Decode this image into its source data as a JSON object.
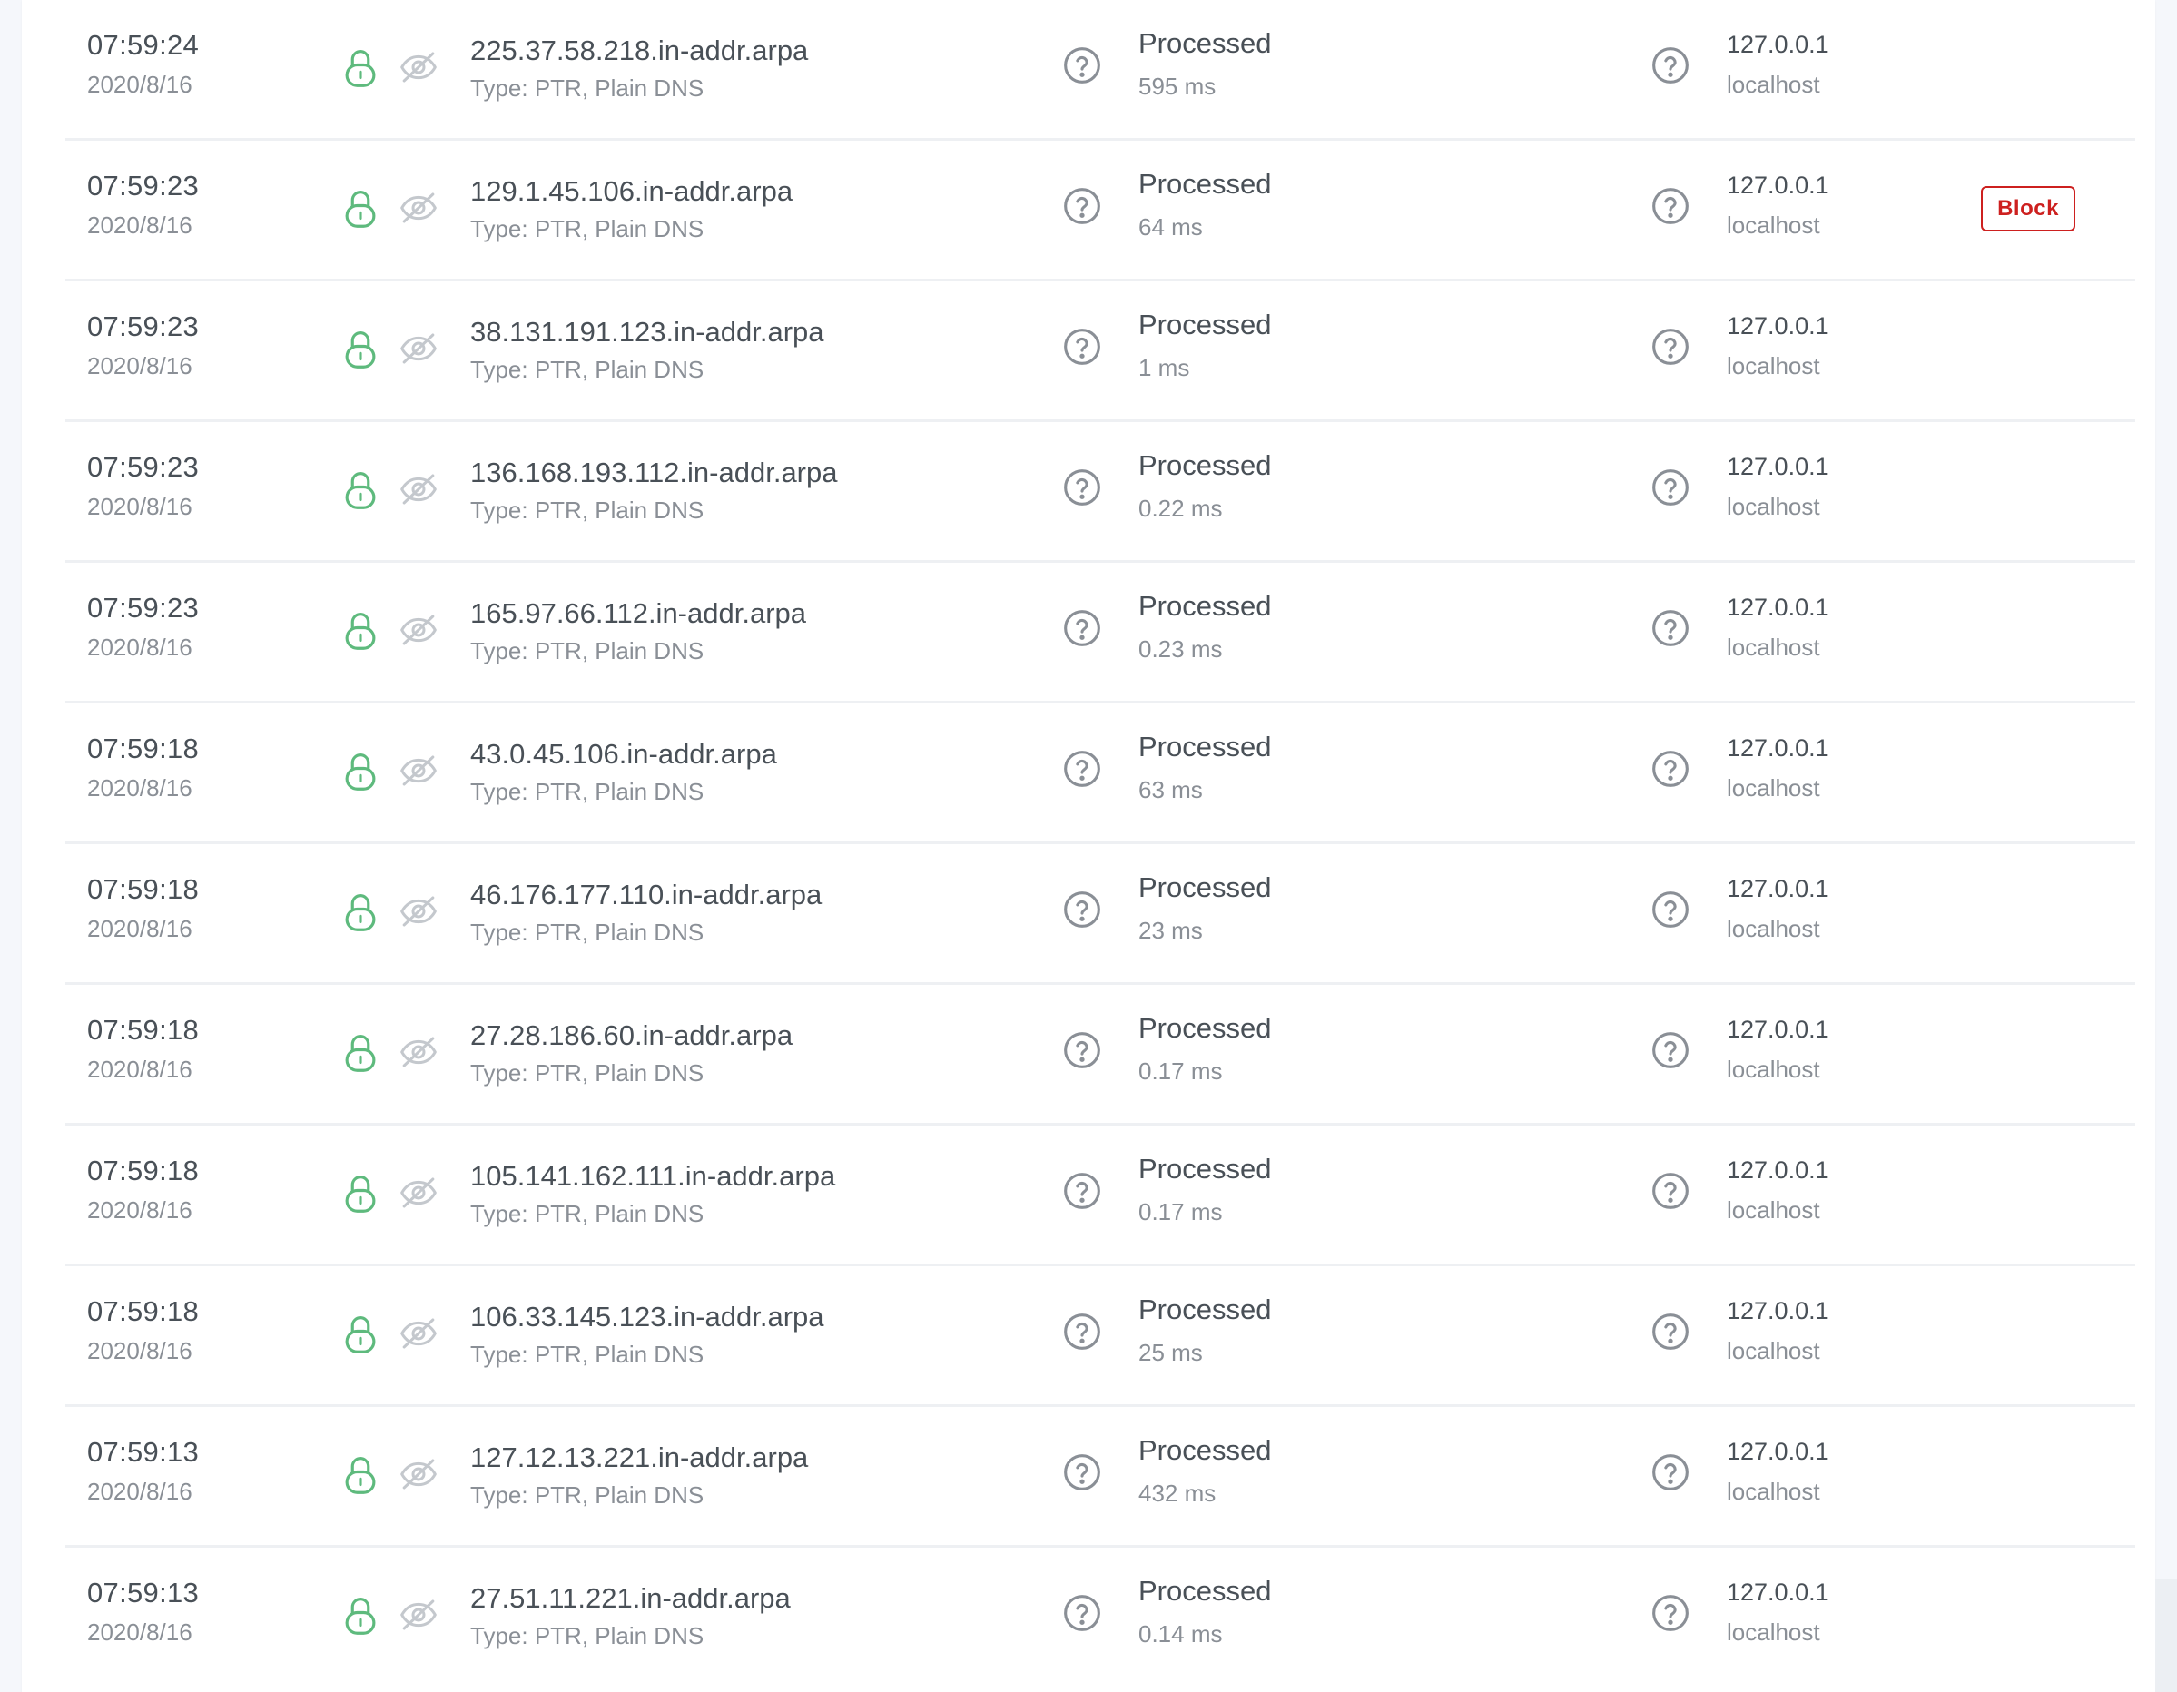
{
  "colors": {
    "lock_green": "#5eba7d",
    "eye_grey": "#c4c8cd",
    "help_grey": "#8a8f96",
    "block_red": "#cd201f"
  },
  "icons": {
    "encryption": "lock-icon",
    "privacy": "eye-off-icon",
    "help": "question-circle-icon"
  },
  "row_action": {
    "block_label": "Block"
  },
  "rows": [
    {
      "time": "07:59:24",
      "date": "2020/8/16",
      "domain": "225.37.58.218.in-addr.arpa",
      "type": "Type: PTR, Plain DNS",
      "status": "Processed",
      "elapsed": "595 ms",
      "client_ip": "127.0.0.1",
      "client_name": "localhost",
      "show_block": false
    },
    {
      "time": "07:59:23",
      "date": "2020/8/16",
      "domain": "129.1.45.106.in-addr.arpa",
      "type": "Type: PTR, Plain DNS",
      "status": "Processed",
      "elapsed": "64 ms",
      "client_ip": "127.0.0.1",
      "client_name": "localhost",
      "show_block": true
    },
    {
      "time": "07:59:23",
      "date": "2020/8/16",
      "domain": "38.131.191.123.in-addr.arpa",
      "type": "Type: PTR, Plain DNS",
      "status": "Processed",
      "elapsed": "1 ms",
      "client_ip": "127.0.0.1",
      "client_name": "localhost",
      "show_block": false
    },
    {
      "time": "07:59:23",
      "date": "2020/8/16",
      "domain": "136.168.193.112.in-addr.arpa",
      "type": "Type: PTR, Plain DNS",
      "status": "Processed",
      "elapsed": "0.22 ms",
      "client_ip": "127.0.0.1",
      "client_name": "localhost",
      "show_block": false
    },
    {
      "time": "07:59:23",
      "date": "2020/8/16",
      "domain": "165.97.66.112.in-addr.arpa",
      "type": "Type: PTR, Plain DNS",
      "status": "Processed",
      "elapsed": "0.23 ms",
      "client_ip": "127.0.0.1",
      "client_name": "localhost",
      "show_block": false
    },
    {
      "time": "07:59:18",
      "date": "2020/8/16",
      "domain": "43.0.45.106.in-addr.arpa",
      "type": "Type: PTR, Plain DNS",
      "status": "Processed",
      "elapsed": "63 ms",
      "client_ip": "127.0.0.1",
      "client_name": "localhost",
      "show_block": false
    },
    {
      "time": "07:59:18",
      "date": "2020/8/16",
      "domain": "46.176.177.110.in-addr.arpa",
      "type": "Type: PTR, Plain DNS",
      "status": "Processed",
      "elapsed": "23 ms",
      "client_ip": "127.0.0.1",
      "client_name": "localhost",
      "show_block": false
    },
    {
      "time": "07:59:18",
      "date": "2020/8/16",
      "domain": "27.28.186.60.in-addr.arpa",
      "type": "Type: PTR, Plain DNS",
      "status": "Processed",
      "elapsed": "0.17 ms",
      "client_ip": "127.0.0.1",
      "client_name": "localhost",
      "show_block": false
    },
    {
      "time": "07:59:18",
      "date": "2020/8/16",
      "domain": "105.141.162.111.in-addr.arpa",
      "type": "Type: PTR, Plain DNS",
      "status": "Processed",
      "elapsed": "0.17 ms",
      "client_ip": "127.0.0.1",
      "client_name": "localhost",
      "show_block": false
    },
    {
      "time": "07:59:18",
      "date": "2020/8/16",
      "domain": "106.33.145.123.in-addr.arpa",
      "type": "Type: PTR, Plain DNS",
      "status": "Processed",
      "elapsed": "25 ms",
      "client_ip": "127.0.0.1",
      "client_name": "localhost",
      "show_block": false
    },
    {
      "time": "07:59:13",
      "date": "2020/8/16",
      "domain": "127.12.13.221.in-addr.arpa",
      "type": "Type: PTR, Plain DNS",
      "status": "Processed",
      "elapsed": "432 ms",
      "client_ip": "127.0.0.1",
      "client_name": "localhost",
      "show_block": false
    },
    {
      "time": "07:59:13",
      "date": "2020/8/16",
      "domain": "27.51.11.221.in-addr.arpa",
      "type": "Type: PTR, Plain DNS",
      "status": "Processed",
      "elapsed": "0.14 ms",
      "client_ip": "127.0.0.1",
      "client_name": "localhost",
      "show_block": false
    }
  ]
}
